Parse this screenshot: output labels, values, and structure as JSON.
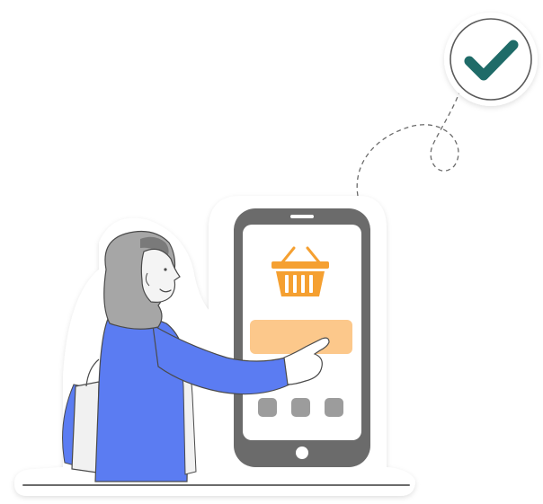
{
  "illustration": {
    "subject": "woman-tapping-phone-shopping-app",
    "screen_icon": "shopping-basket-icon",
    "badge_icon": "check-mark-icon",
    "nav_buttons_count": 3
  },
  "colors": {
    "background": "#ffffff",
    "phone_body": "#6b6b6b",
    "phone_screen": "#ffffff",
    "basket": "#f5a031",
    "buy_button": "#fcc88b",
    "nav_button": "#9c9c9c",
    "check_mark": "#1f6b68",
    "sleeve": "#5b7cf2",
    "hijab": "#a6a6a6",
    "skin": "#f4f4f4",
    "outline": "#4a4a4a"
  }
}
